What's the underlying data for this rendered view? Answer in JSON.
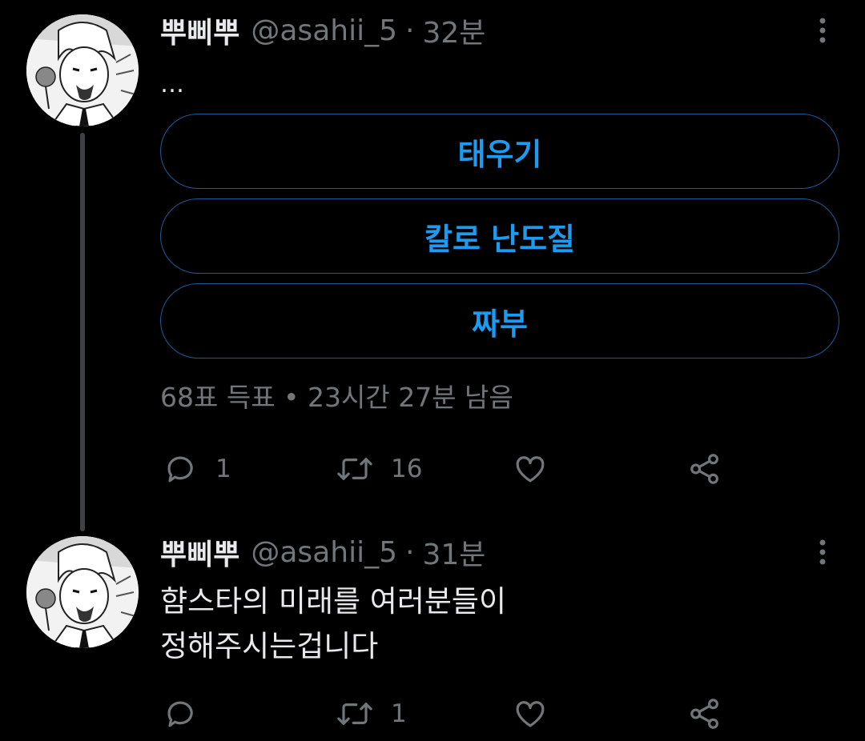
{
  "colors": {
    "background": "#000000",
    "text": "#e7e9ea",
    "muted": "#71767b",
    "accent": "#1d9bf0",
    "thread_line": "#3e4144"
  },
  "tweets": [
    {
      "author": {
        "display_name": "뿌삐뿌",
        "handle": "@asahii_5",
        "avatar_icon": "avatar-illustration"
      },
      "separator": "·",
      "time": "32분",
      "text": "…",
      "poll": {
        "options": [
          "태우기",
          "칼로 난도질",
          "짜부"
        ],
        "meta": "68표 득표 • 23시간 27분 남음"
      },
      "actions": {
        "reply": {
          "icon": "reply-icon",
          "count": "1"
        },
        "retweet": {
          "icon": "retweet-icon",
          "count": "16"
        },
        "like": {
          "icon": "heart-icon",
          "count": ""
        },
        "share": {
          "icon": "share-icon",
          "count": ""
        }
      }
    },
    {
      "author": {
        "display_name": "뿌삐뿌",
        "handle": "@asahii_5",
        "avatar_icon": "avatar-illustration"
      },
      "separator": "·",
      "time": "31분",
      "text": "햠스타의 미래를 여러분들이\n정해주시는겁니다",
      "actions": {
        "reply": {
          "icon": "reply-icon",
          "count": ""
        },
        "retweet": {
          "icon": "retweet-icon",
          "count": "1"
        },
        "like": {
          "icon": "heart-icon",
          "count": ""
        },
        "share": {
          "icon": "share-icon",
          "count": ""
        }
      }
    }
  ]
}
